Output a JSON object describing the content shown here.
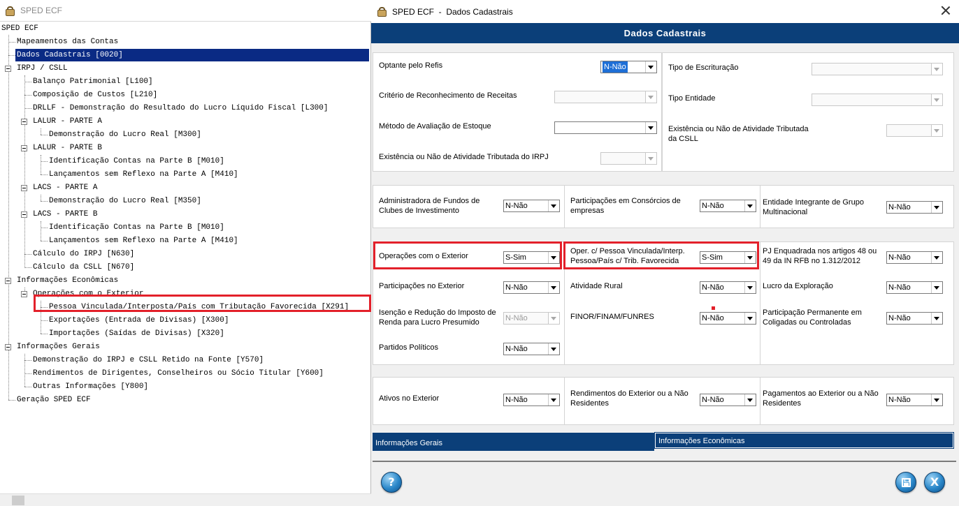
{
  "left_window": {
    "title": "SPED ECF",
    "tree": [
      {
        "label": "SPED ECF"
      },
      {
        "label": "Mapeamentos das Contas"
      },
      {
        "label": "Dados Cadastrais [0020]"
      },
      {
        "label": "IRPJ / CSLL"
      },
      {
        "label": "Balanço Patrimonial [L100]"
      },
      {
        "label": "Composição de Custos [L210]"
      },
      {
        "label": "DRLLF - Demonstração do Resultado do Lucro Líquido Fiscal [L300]"
      },
      {
        "label": "LALUR - PARTE A"
      },
      {
        "label": "Demonstração do Lucro Real [M300]"
      },
      {
        "label": "LALUR - PARTE B"
      },
      {
        "label": "Identificação Contas na Parte B [M010]"
      },
      {
        "label": "Lançamentos sem Reflexo na Parte A [M410]"
      },
      {
        "label": "LACS - PARTE A"
      },
      {
        "label": "Demonstração do Lucro Real [M350]"
      },
      {
        "label": "LACS - PARTE B"
      },
      {
        "label": "Identificação Contas na Parte B [M010]"
      },
      {
        "label": "Lançamentos sem Reflexo na Parte A [M410]"
      },
      {
        "label": "Cálculo do IRPJ [N630]"
      },
      {
        "label": "Cálculo da CSLL [N670]"
      },
      {
        "label": "Informações Econômicas"
      },
      {
        "label": "Operações com o Exterior"
      },
      {
        "label": "Pessoa Vinculada/Interposta/País com Tributação Favorecida [X291]"
      },
      {
        "label": "Exportações (Entrada de Divisas) [X300]"
      },
      {
        "label": "Importações (Saídas de Divisas) [X320]"
      },
      {
        "label": "Informações Gerais"
      },
      {
        "label": "Demonstração do IRPJ e CSLL Retido na Fonte [Y570]"
      },
      {
        "label": "Rendimentos de Dirigentes, Conselheiros ou Sócio Titular [Y600]"
      },
      {
        "label": "Outras Informações [Y800]"
      },
      {
        "label": "Geração SPED ECF"
      }
    ]
  },
  "right_window": {
    "title": "SPED ECF  -  Dados Cadastrais",
    "banner": "Dados Cadastrais",
    "section1_left": {
      "refis_label": "Optante pelo Refis",
      "refis_value": "N-Não",
      "criterio_label": "Critério de Reconhecimento de Receitas",
      "criterio_value": "",
      "metodo_label": "Método de Avaliação de Estoque",
      "metodo_value": "",
      "exist_irpj_label": "Existência ou Não de Atividade Tributada do IRPJ",
      "exist_irpj_value": ""
    },
    "section1_right": {
      "tipo_escrit_label": "Tipo de Escrituração",
      "tipo_escrit_value": "",
      "tipo_entidade_label": "Tipo Entidade",
      "tipo_entidade_value": "",
      "exist_csll_label": "Existência ou Não de Atividade Tributada da CSLL",
      "exist_csll_value": ""
    },
    "section2": {
      "adm_fundos_label": "Administradora de Fundos de Clubes de Investimento",
      "adm_fundos_value": "N-Não",
      "consorcios_label": "Participações em Consórcios de empresas",
      "consorcios_value": "N-Não",
      "grupo_multi_label": "Entidade Integrante de Grupo Multinacional",
      "grupo_multi_value": "N-Não"
    },
    "section3": {
      "oper_exterior_label": "Operações com o Exterior",
      "oper_exterior_value": "S-Sim",
      "oper_pessoa_label": "Oper. c/ Pessoa Vinculada/Interp. Pessoa/País c/ Trib. Favorecida",
      "oper_pessoa_value": "S-Sim",
      "pj_enq_label": "PJ Enquadrada nos artigos 48 ou 49 da IN RFB no 1.312/2012",
      "pj_enq_value": "N-Não",
      "part_exterior_label": "Participações no Exterior",
      "part_exterior_value": "N-Não",
      "ativ_rural_label": "Atividade Rural",
      "ativ_rural_value": "N-Não",
      "lucro_expl_label": "Lucro da Exploração",
      "lucro_expl_value": "N-Não",
      "isencao_label": "Isenção e Redução do Imposto de Renda para Lucro Presumido",
      "isencao_value": "N-Não",
      "finor_label": "FINOR/FINAM/FUNRES",
      "finor_value": "N-Não",
      "part_perm_label": "Participação Permanente em Coligadas ou Controladas",
      "part_perm_value": "N-Não",
      "partidos_label": "Partidos Políticos",
      "partidos_value": "N-Não"
    },
    "section4": {
      "ativos_ext_label": "Ativos no Exterior",
      "ativos_ext_value": "N-Não",
      "rend_ext_label": "Rendimentos do Exterior ou a Não Residentes",
      "rend_ext_value": "N-Não",
      "pag_ext_label": "Pagamentos ao Exterior ou a Não Residentes",
      "pag_ext_value": "N-Não"
    },
    "tabs": {
      "general": "Informações Gerais",
      "economic": "Informações Econômicas"
    },
    "buttons": {
      "help": "?",
      "close": "X"
    },
    "colors": {
      "banner": "#0b3f79",
      "selection": "#0a2a84",
      "highlight_box": "#e3202a"
    }
  }
}
